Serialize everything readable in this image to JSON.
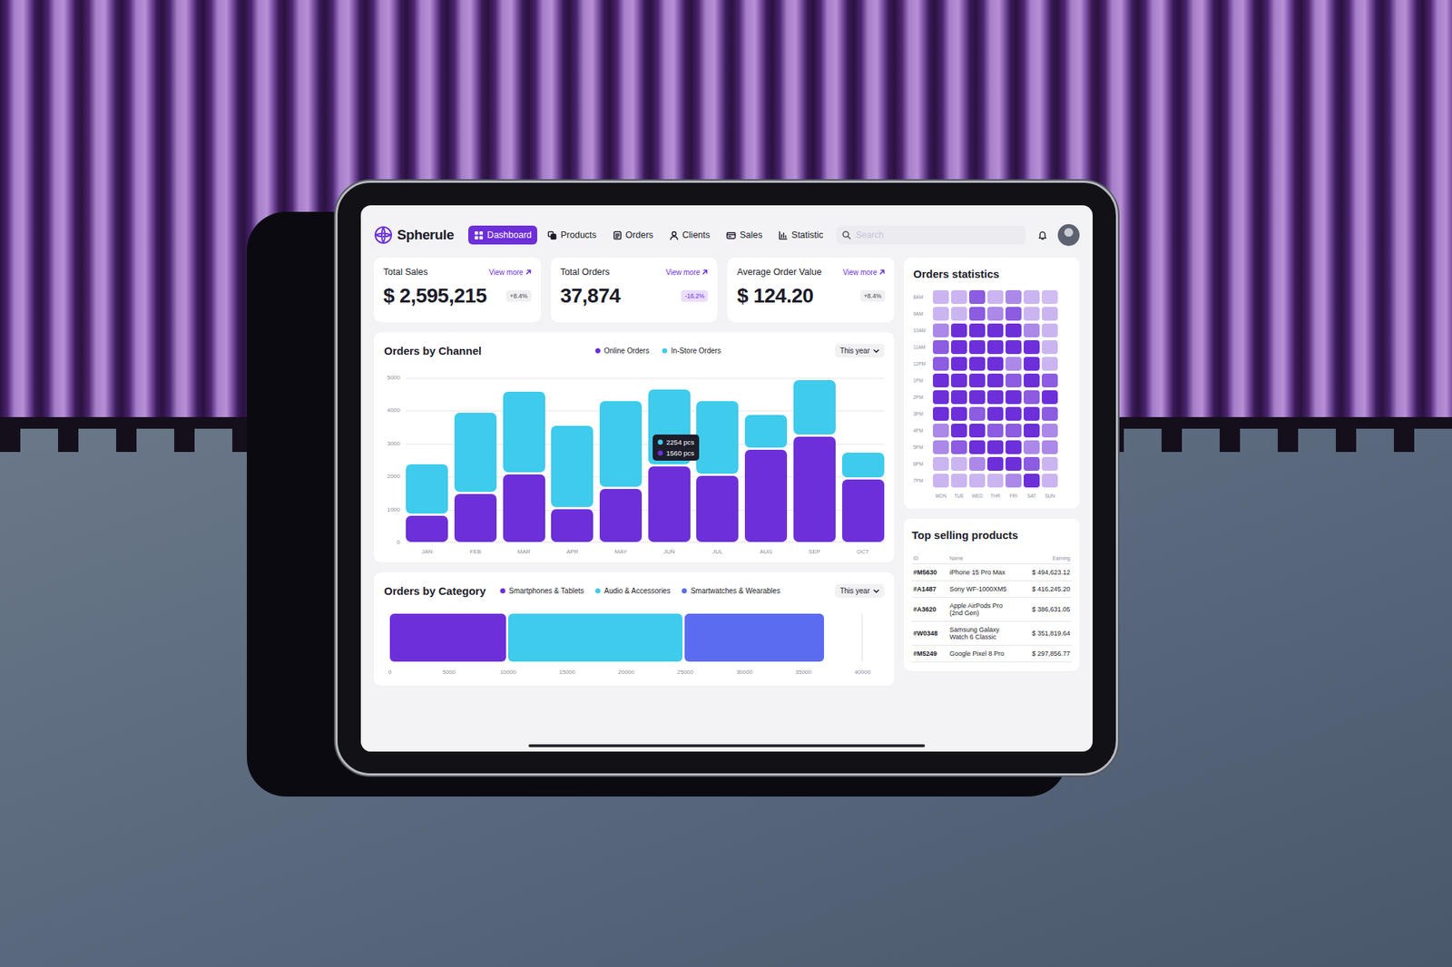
{
  "app": {
    "name": "Spherule"
  },
  "nav": [
    {
      "label": "Dashboard",
      "selected": true
    },
    {
      "label": "Products",
      "selected": false
    },
    {
      "label": "Orders",
      "selected": false
    },
    {
      "label": "Clients",
      "selected": false
    },
    {
      "label": "Sales",
      "selected": false
    },
    {
      "label": "Statistic",
      "selected": false
    }
  ],
  "search": {
    "placeholder": "Search"
  },
  "stats": [
    {
      "title": "Total Sales",
      "link": "View more",
      "value": "$ 2,595,215",
      "change": "+8.4%",
      "negative": false
    },
    {
      "title": "Total Orders",
      "link": "View more",
      "value": "37,874",
      "change": "-16.2%",
      "negative": true
    },
    {
      "title": "Average Order Value",
      "link": "View more",
      "value": "$ 124.20",
      "change": "+8.4%",
      "negative": false
    }
  ],
  "channel_chart": {
    "title": "Orders by Channel",
    "period": "This year",
    "legend": [
      {
        "label": "Online Orders",
        "color": "#6d2fd9"
      },
      {
        "label": "In-Store Orders",
        "color": "#3ecbec"
      }
    ],
    "y_ticks": [
      "5000",
      "4000",
      "3000",
      "2000",
      "1000",
      "0"
    ],
    "months": [
      {
        "label": "JAN",
        "hovered": false
      },
      {
        "label": "FEB",
        "hovered": false
      },
      {
        "label": "MAR",
        "hovered": false
      },
      {
        "label": "APR",
        "hovered": false
      },
      {
        "label": "MAY",
        "hovered": false
      },
      {
        "label": "JUN",
        "hovered": true
      },
      {
        "label": "JUL",
        "hovered": false
      },
      {
        "label": "AUG",
        "hovered": false
      },
      {
        "label": "SEP",
        "hovered": false
      },
      {
        "label": "OCT",
        "hovered": false
      }
    ],
    "online": [
      800,
      1450,
      2050,
      1000,
      1600,
      2300,
      2000,
      2800,
      3200,
      1900
    ],
    "in_store": [
      1500,
      2400,
      2450,
      2450,
      2600,
      2254,
      2200,
      1000,
      1650,
      750
    ],
    "tooltip": [
      {
        "text": "2254 pcs",
        "color": "#3ecbec"
      },
      {
        "text": "1560 pcs",
        "color": "#6d2fd9"
      }
    ]
  },
  "category_chart": {
    "title": "Orders by Category",
    "period": "This year",
    "legend": [
      {
        "label": "Smartphones & Tablets",
        "color": "#6d2fd9"
      },
      {
        "label": "Audio & Accessories",
        "color": "#3ecbec"
      },
      {
        "label": "Smartwatches & Wearables",
        "color": "#5b6cf0"
      }
    ],
    "values": [
      10000,
      15000,
      12000
    ],
    "x_ticks": [
      "0",
      "5000",
      "10000",
      "15000",
      "20000",
      "25000",
      "30000",
      "35000",
      "40000"
    ]
  },
  "heatmap": {
    "title": "Orders statistics",
    "hours": [
      "8AM",
      "9AM",
      "10AM",
      "11AM",
      "12PM",
      "1PM",
      "2PM",
      "3PM",
      "4PM",
      "5PM",
      "6PM",
      "7PM"
    ],
    "days": [
      "MON",
      "TUE",
      "WED",
      "THR",
      "FRI",
      "SAT",
      "SUN"
    ],
    "levels": [
      [
        0.25,
        0.25,
        0.75,
        0.25,
        0.5,
        0.25,
        0.2
      ],
      [
        0.25,
        0.25,
        0.75,
        0.5,
        0.75,
        0.25,
        0.25
      ],
      [
        0.5,
        1,
        1,
        1,
        1,
        0.5,
        0.25
      ],
      [
        0.75,
        1,
        1,
        1,
        1,
        1,
        0.25
      ],
      [
        0.75,
        1,
        1,
        1,
        0.5,
        1,
        0.25
      ],
      [
        1,
        1,
        1,
        1,
        0.75,
        1,
        0.75
      ],
      [
        1,
        1,
        1,
        1,
        1,
        0.75,
        1
      ],
      [
        1,
        1,
        0.75,
        1,
        1,
        1,
        0.75
      ],
      [
        0.5,
        1,
        1,
        0.75,
        0.75,
        1,
        0.5
      ],
      [
        0.5,
        0.75,
        1,
        1,
        1,
        0.5,
        0.5
      ],
      [
        0.25,
        0.25,
        0.5,
        1,
        1,
        0.75,
        0.25
      ],
      [
        0.25,
        0.25,
        0.25,
        0.25,
        0.5,
        1,
        0.25
      ]
    ]
  },
  "top_products": {
    "title": "Top selling products",
    "columns": [
      "ID",
      "Name",
      "Earning"
    ],
    "rows": [
      [
        "#M5630",
        "iPhone 15 Pro Max",
        "$ 494,623.12"
      ],
      [
        "#A1487",
        "Sony WF-1000XM5",
        "$ 416,245.20"
      ],
      [
        "#A3620",
        "Apple AirPods Pro (2nd Gen)",
        "$ 386,631.05"
      ],
      [
        "#W0348",
        "Samsung Galaxy Watch 6 Classic",
        "$ 351,819.64"
      ],
      [
        "#M5249",
        "Google Pixel 8 Pro",
        "$ 297,856.77"
      ]
    ]
  }
}
